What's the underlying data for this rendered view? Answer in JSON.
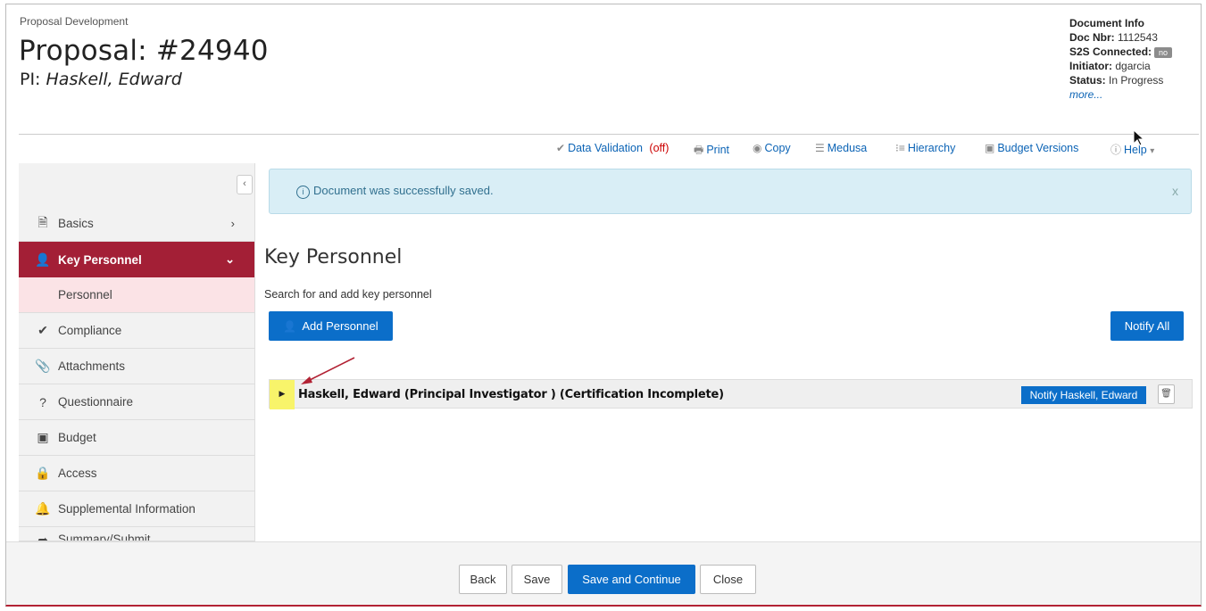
{
  "header": {
    "module": "Proposal Development",
    "title": "Proposal: #24940",
    "pi_label": "PI:",
    "pi_name": "Haskell, Edward"
  },
  "document_info": {
    "heading": "Document Info",
    "doc_nbr_label": "Doc Nbr:",
    "doc_nbr": "1112543",
    "s2s_label": "S2S Connected:",
    "s2s_value": "no",
    "initiator_label": "Initiator:",
    "initiator": "dgarcia",
    "status_label": "Status:",
    "status": "In Progress",
    "more": "more..."
  },
  "toolbar": {
    "data_validation": "Data Validation",
    "data_validation_state": "(off)",
    "print": "Print",
    "copy": "Copy",
    "medusa": "Medusa",
    "hierarchy": "Hierarchy",
    "budget_versions": "Budget Versions",
    "help": "Help"
  },
  "sidebar": {
    "items": [
      {
        "label": "Basics",
        "icon": "document-icon"
      },
      {
        "label": "Key Personnel",
        "icon": "user-icon"
      },
      {
        "label": "Personnel",
        "icon": ""
      },
      {
        "label": "Compliance",
        "icon": "check-icon"
      },
      {
        "label": "Attachments",
        "icon": "paperclip-icon"
      },
      {
        "label": "Questionnaire",
        "icon": "question-icon"
      },
      {
        "label": "Budget",
        "icon": "money-icon"
      },
      {
        "label": "Access",
        "icon": "lock-icon"
      },
      {
        "label": "Supplemental Information",
        "icon": "bell-icon"
      },
      {
        "label": "Summary/Submit",
        "icon": "share-icon"
      }
    ]
  },
  "alert": {
    "message": "Document was successfully saved.",
    "close": "x"
  },
  "main": {
    "heading": "Key Personnel",
    "subtitle": "Search for and add key personnel",
    "add_button": "Add Personnel",
    "notify_all_button": "Notify All",
    "personnel": [
      {
        "name": "Haskell, Edward (Principal Investigator ) (Certification Incomplete)",
        "notify_label": "Notify Haskell, Edward"
      }
    ]
  },
  "footer": {
    "back": "Back",
    "save": "Save",
    "save_continue": "Save and Continue",
    "close": "Close"
  },
  "colors": {
    "accent": "#a31f36",
    "primary_button": "#0b6ec9",
    "alert_bg": "#d9eef6",
    "highlight": "#f8f46a",
    "annotation_arrow": "#b22234"
  }
}
